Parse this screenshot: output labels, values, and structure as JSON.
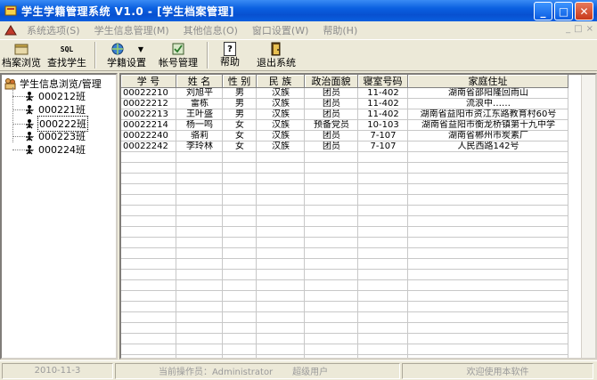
{
  "window": {
    "title": "学生学籍管理系统 V1.0 - [学生档案管理]",
    "minimize_label": "_",
    "maximize_label": "□",
    "close_label": "✕"
  },
  "menu": {
    "items": [
      "系统选项(S)",
      "学生信息管理(M)",
      "其他信息(O)",
      "窗口设置(W)",
      "帮助(H)"
    ],
    "mdi_buttons": [
      "_",
      "□",
      "×"
    ]
  },
  "toolbar": {
    "buttons": [
      {
        "label": "档案浏览",
        "icon": "archive-icon"
      },
      {
        "label": "查找学生",
        "icon": "sql-search-icon",
        "icon_text": "SQL"
      },
      {
        "label": "学籍设置",
        "icon": "globe-settings-icon"
      },
      {
        "label": "帐号管理",
        "icon": "account-icon"
      },
      {
        "label": "帮助",
        "icon": "help-icon",
        "icon_text": "?"
      },
      {
        "label": "退出系统",
        "icon": "exit-door-icon"
      }
    ]
  },
  "tree": {
    "root_label": "学生信息浏览/管理",
    "nodes": [
      "000212班",
      "000221班",
      "000222班",
      "000223班",
      "000224班"
    ],
    "selected_index": 2
  },
  "grid": {
    "columns": [
      "学    号",
      "姓  名",
      "性 别",
      "民  族",
      "政治面貌",
      "寝室号码",
      "家庭住址"
    ],
    "rows": [
      [
        "00022210",
        "刘旭平",
        "男",
        "汉族",
        "团员",
        "11-402",
        "湖南省邵阳隆回雨山"
      ],
      [
        "00022212",
        "雷栋",
        "男",
        "汉族",
        "团员",
        "11-402",
        "流浪中……"
      ],
      [
        "00022213",
        "王叶盛",
        "男",
        "汉族",
        "团员",
        "11-402",
        "湖南省益阳市资江东路教育村60号"
      ],
      [
        "00022214",
        "杨一鸣",
        "女",
        "汉族",
        "预备党员",
        "10-103",
        "湖南省益阳市衡龙桥镇第十九中学"
      ],
      [
        "00022240",
        "骆莉",
        "女",
        "汉族",
        "团员",
        "7-107",
        "湖南省郴州市炭素厂"
      ],
      [
        "00022242",
        "李玲林",
        "女",
        "汉族",
        "团员",
        "7-107",
        "人民西路142号"
      ]
    ]
  },
  "status": {
    "date": "2010-11-3",
    "operator": "当前操作员：Administrator",
    "role": "超级用户",
    "welcome": "欢迎使用本软件"
  },
  "colors": {
    "title_bar": "#0a5fe0",
    "menu_disabled": "#8c8c8c",
    "grid_line": "#c8c8c8",
    "face": "#ece9d8"
  }
}
